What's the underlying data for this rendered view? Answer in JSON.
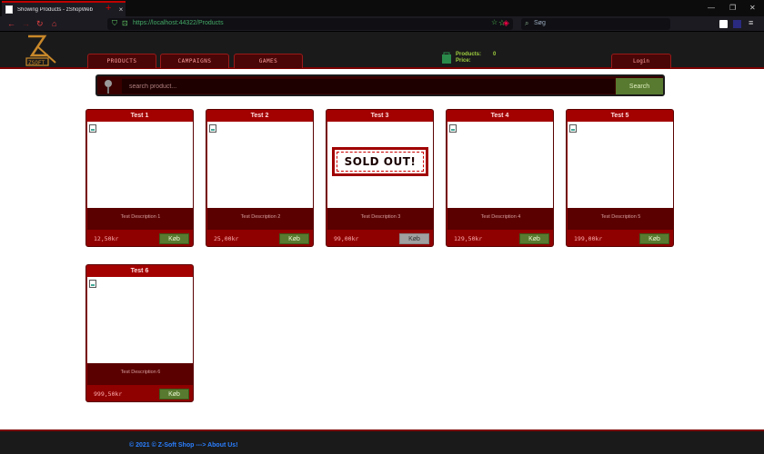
{
  "browser": {
    "tab_title": "Showing Products - zShopWeb",
    "tab_close": "×",
    "new_tab": "+",
    "url": "https://localhost:44322/Products",
    "search_placeholder": "Søg",
    "minimize": "—",
    "restore": "❐",
    "close": "✕"
  },
  "header": {
    "menu": [
      {
        "label": "PRODUCTS"
      },
      {
        "label": "CAMPAIGNS"
      },
      {
        "label": "GAMES"
      }
    ],
    "cart": {
      "products_label": "Products:",
      "price_label": "Price:",
      "products_value": "0",
      "price_value": ""
    },
    "login_label": "Login"
  },
  "search": {
    "placeholder": "search product...",
    "button_label": "Search"
  },
  "products": [
    {
      "name": "Test 1",
      "description": "Test Description 1",
      "price": "12,50kr",
      "buy_label": "Køb",
      "sold_out": false
    },
    {
      "name": "Test 2",
      "description": "Test Description 2",
      "price": "25,00kr",
      "buy_label": "Køb",
      "sold_out": false
    },
    {
      "name": "Test 3",
      "description": "Test Description 3",
      "price": "99,00kr",
      "buy_label": "Køb",
      "sold_out": true,
      "sold_out_label": "SOLD OUT!"
    },
    {
      "name": "Test 4",
      "description": "Test Description 4",
      "price": "129,50kr",
      "buy_label": "Køb",
      "sold_out": false
    },
    {
      "name": "Test 5",
      "description": "Test Description 5",
      "price": "199,00kr",
      "buy_label": "Køb",
      "sold_out": false
    },
    {
      "name": "Test 6",
      "description": "Test Description 6",
      "price": "999,50kr",
      "buy_label": "Køb",
      "sold_out": false
    }
  ],
  "footer": {
    "text": "© 2021 © Z-Soft Shop ---> About Us!"
  },
  "colors": {
    "accent_red": "#8f0000",
    "buy_green": "#587a30",
    "footer_link": "#2a7fff"
  }
}
